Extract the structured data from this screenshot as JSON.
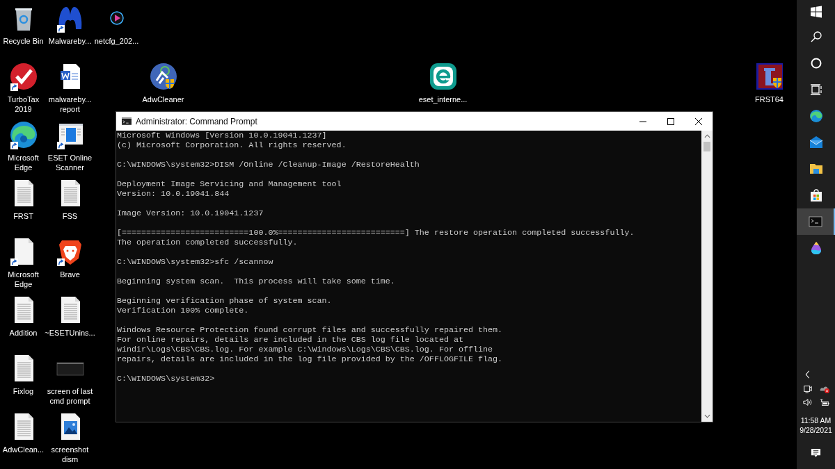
{
  "desktop_icons": [
    {
      "label": "Recycle Bin",
      "kind": "recycle-bin",
      "shortcut": false
    },
    {
      "label": "Malwareby...",
      "kind": "malwarebytes",
      "shortcut": true
    },
    {
      "label": "netcfg_202...",
      "kind": "media",
      "shortcut": false
    },
    {
      "label": "TurboTax 2019",
      "kind": "turbotax",
      "shortcut": true
    },
    {
      "label": "malwareby... report",
      "kind": "word-doc",
      "shortcut": false
    },
    {
      "label": "AdwCleaner",
      "kind": "adwcleaner",
      "shortcut": false
    },
    {
      "label": "eset_interne...",
      "kind": "eset",
      "shortcut": false
    },
    {
      "label": "FRST64",
      "kind": "frst",
      "shortcut": false
    },
    {
      "label": "Microsoft Edge",
      "kind": "edge",
      "shortcut": true
    },
    {
      "label": "ESET Online Scanner",
      "kind": "window-app",
      "shortcut": true
    },
    {
      "label": "FRST",
      "kind": "text-file",
      "shortcut": false
    },
    {
      "label": "FSS",
      "kind": "text-file",
      "shortcut": false
    },
    {
      "label": "Microsoft Edge",
      "kind": "blank-doc",
      "shortcut": true
    },
    {
      "label": "Brave",
      "kind": "brave",
      "shortcut": true
    },
    {
      "label": "Addition",
      "kind": "text-file",
      "shortcut": false
    },
    {
      "label": "~ESETUnins...",
      "kind": "text-file",
      "shortcut": false
    },
    {
      "label": "Fixlog",
      "kind": "text-file",
      "shortcut": false
    },
    {
      "label": "screen of last cmd prompt",
      "kind": "thumbnail",
      "shortcut": false
    },
    {
      "label": "AdwClean...",
      "kind": "text-file",
      "shortcut": false
    },
    {
      "label": "screenshot dism",
      "kind": "image-file",
      "shortcut": false
    }
  ],
  "window": {
    "title": "Administrator: Command Prompt",
    "console": [
      [
        "Microsoft Windows [Version 10.0.19041.1237]",
        "(c) Microsoft Corporation. All rights reserved."
      ],
      [
        "C:\\WINDOWS\\system32>DISM /Online /Cleanup-Image /RestoreHealth"
      ],
      [
        "Deployment Image Servicing and Management tool",
        "Version: 10.0.19041.844"
      ],
      [
        "Image Version: 10.0.19041.1237"
      ],
      [
        "[==========================100.0%==========================] The restore operation completed successfully.",
        "The operation completed successfully."
      ],
      [
        "C:\\WINDOWS\\system32>sfc /scannow"
      ],
      [
        "Beginning system scan.  This process will take some time."
      ],
      [
        "Beginning verification phase of system scan.",
        "Verification 100% complete."
      ],
      [
        "Windows Resource Protection found corrupt files and successfully repaired them.",
        "For online repairs, details are included in the CBS log file located at",
        "windir\\Logs\\CBS\\CBS.log. For example C:\\Windows\\Logs\\CBS\\CBS.log. For offline",
        "repairs, details are included in the log file provided by the /OFFLOGFILE flag."
      ],
      [
        "C:\\WINDOWS\\system32>"
      ]
    ]
  },
  "taskbar": {
    "apps": [
      {
        "kind": "start",
        "selected": false
      },
      {
        "kind": "search",
        "selected": false
      },
      {
        "kind": "cortana",
        "selected": false
      },
      {
        "kind": "task-view",
        "selected": false
      },
      {
        "kind": "edge",
        "selected": false
      },
      {
        "kind": "mail",
        "selected": false
      },
      {
        "kind": "explorer",
        "selected": false
      },
      {
        "kind": "store",
        "selected": false
      },
      {
        "kind": "terminal",
        "selected": true
      },
      {
        "kind": "paint",
        "selected": false
      }
    ],
    "tray": [
      {
        "kind": "chevron"
      },
      {
        "kind": "webcam"
      },
      {
        "kind": "onedrive-error"
      },
      {
        "kind": "speaker"
      },
      {
        "kind": "battery"
      }
    ],
    "time": "11:58 AM",
    "date": "9/28/2021"
  }
}
